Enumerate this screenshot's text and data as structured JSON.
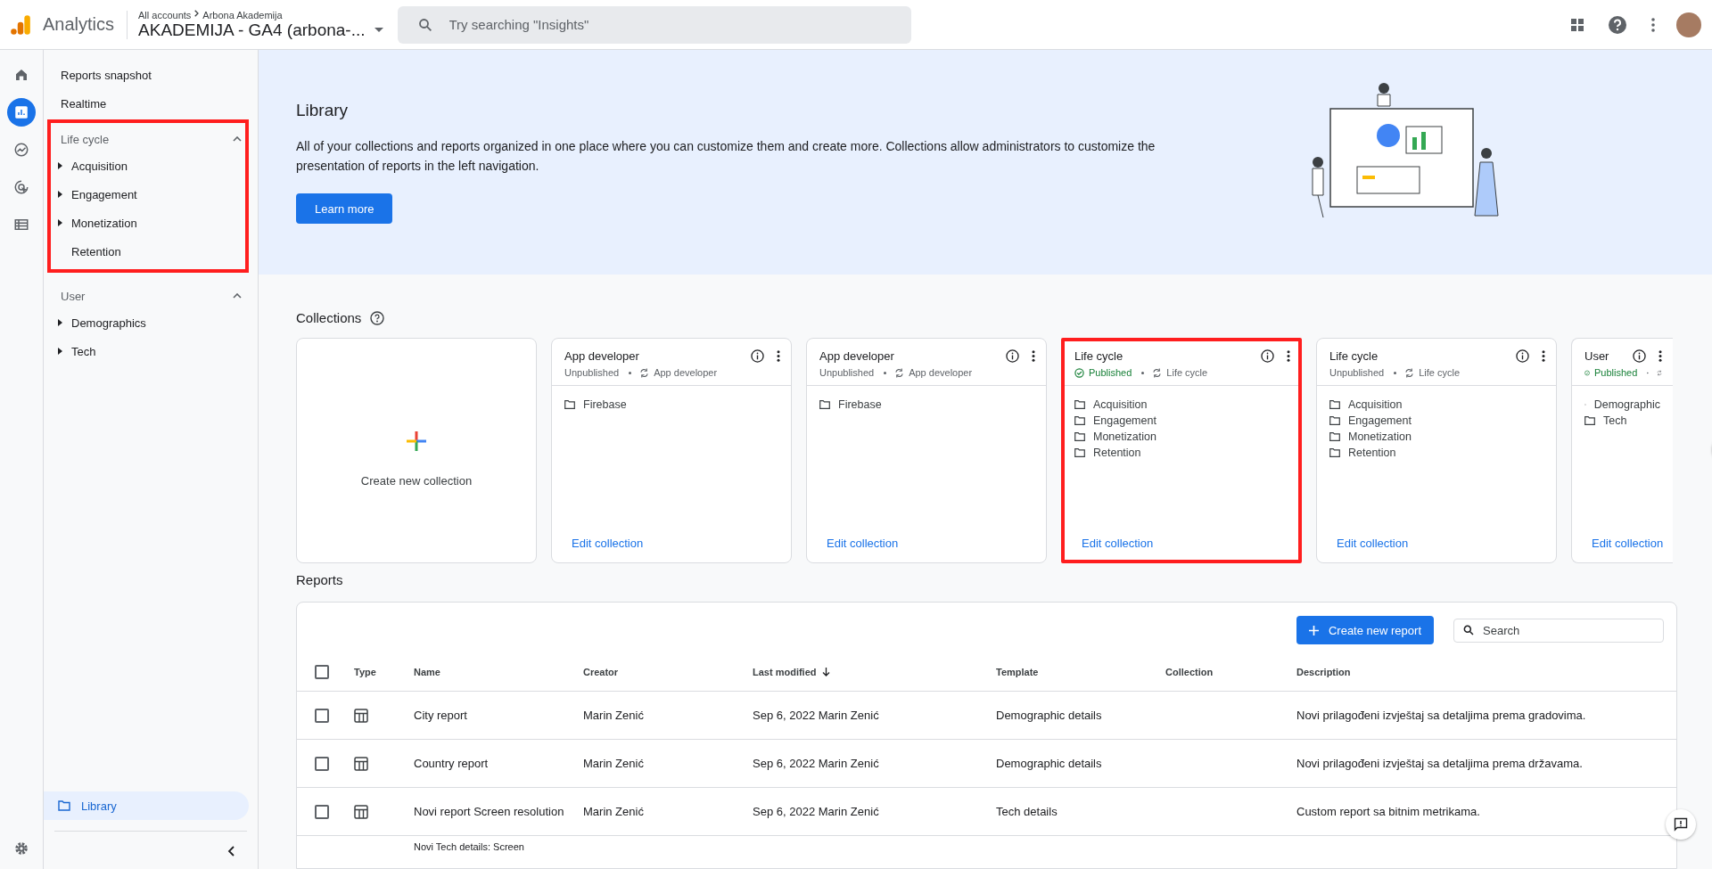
{
  "header": {
    "product": "Analytics",
    "breadcrumb": [
      "All accounts",
      "Arbona Akademija"
    ],
    "property": "AKADEMIJA - GA4 (arbona-...",
    "search": {
      "placeholder": "Try searching \"Insights\""
    }
  },
  "rail": [
    {
      "kind": "home",
      "selected": false
    },
    {
      "kind": "reports",
      "selected": true
    },
    {
      "kind": "explore",
      "selected": false
    },
    {
      "kind": "advertising",
      "selected": false
    },
    {
      "kind": "configure",
      "selected": false
    }
  ],
  "nav": {
    "top_items": [
      "Reports snapshot",
      "Realtime"
    ],
    "sections": [
      {
        "title": "Life cycle",
        "expanded": true,
        "highlighted": true,
        "items": [
          {
            "label": "Acquisition",
            "has_children": true
          },
          {
            "label": "Engagement",
            "has_children": true
          },
          {
            "label": "Monetization",
            "has_children": true
          },
          {
            "label": "Retention",
            "has_children": false
          }
        ]
      },
      {
        "title": "User",
        "expanded": true,
        "highlighted": false,
        "items": [
          {
            "label": "Demographics",
            "has_children": true
          },
          {
            "label": "Tech",
            "has_children": true
          }
        ]
      }
    ],
    "library": {
      "label": "Library",
      "selected": true
    }
  },
  "banner": {
    "title": "Library",
    "text": "All of your collections and reports organized in one place where you can customize them and create more. Collections allow administrators to customize the presentation of reports in the left navigation.",
    "button": "Learn more"
  },
  "collections": {
    "title": "Collections",
    "create_label": "Create new collection",
    "cards": [
      {
        "title": "App developer",
        "status": "Unpublished",
        "published": false,
        "template": "App developer",
        "highlighted": false,
        "items": [
          "Firebase"
        ],
        "link": "Edit collection"
      },
      {
        "title": "App developer",
        "status": "Unpublished",
        "published": false,
        "template": "App developer",
        "highlighted": false,
        "items": [
          "Firebase"
        ],
        "link": "Edit collection"
      },
      {
        "title": "Life cycle",
        "status": "Published",
        "published": true,
        "template": "Life cycle",
        "highlighted": true,
        "items": [
          "Acquisition",
          "Engagement",
          "Monetization",
          "Retention"
        ],
        "link": "Edit collection"
      },
      {
        "title": "Life cycle",
        "status": "Unpublished",
        "published": false,
        "template": "Life cycle",
        "highlighted": false,
        "items": [
          "Acquisition",
          "Engagement",
          "Monetization",
          "Retention"
        ],
        "link": "Edit collection"
      },
      {
        "title": "User",
        "status": "Published",
        "published": true,
        "highlighted": false,
        "items": [
          "Demographic",
          "Tech"
        ],
        "link": "Edit collection"
      }
    ]
  },
  "reports": {
    "title": "Reports",
    "select_all_checked": false,
    "create_button": "Create new report",
    "search": {
      "placeholder": "Search"
    },
    "columns": [
      {
        "label": "Type",
        "sorted": false
      },
      {
        "label": "Name",
        "sorted": false
      },
      {
        "label": "Creator",
        "sorted": false
      },
      {
        "label": "Last modified",
        "sorted": true
      },
      {
        "label": "Template",
        "sorted": false
      },
      {
        "label": "Collection",
        "sorted": false
      },
      {
        "label": "Description",
        "sorted": false
      }
    ],
    "rows": [
      {
        "checked": false,
        "name": "City report",
        "creator": "Marin Zenić",
        "last_modified": "Sep 6, 2022 Marin Zenić",
        "template": "Demographic details",
        "description": "Novi prilagođeni izvještaj sa detaljima prema gradovima."
      },
      {
        "checked": false,
        "name": "Country report",
        "creator": "Marin Zenić",
        "last_modified": "Sep 6, 2022 Marin Zenić",
        "template": "Demographic details",
        "description": "Novi prilagođeni izvještaj sa detaljima prema državama."
      },
      {
        "checked": false,
        "name": "Novi report Screen resolution",
        "creator": "Marin Zenić",
        "last_modified": "Sep 6, 2022 Marin Zenić",
        "template": "Tech details",
        "description": "Custom report sa bitnim metrikama."
      }
    ],
    "partial_row": {
      "name": "Novi Tech details: Screen"
    }
  }
}
